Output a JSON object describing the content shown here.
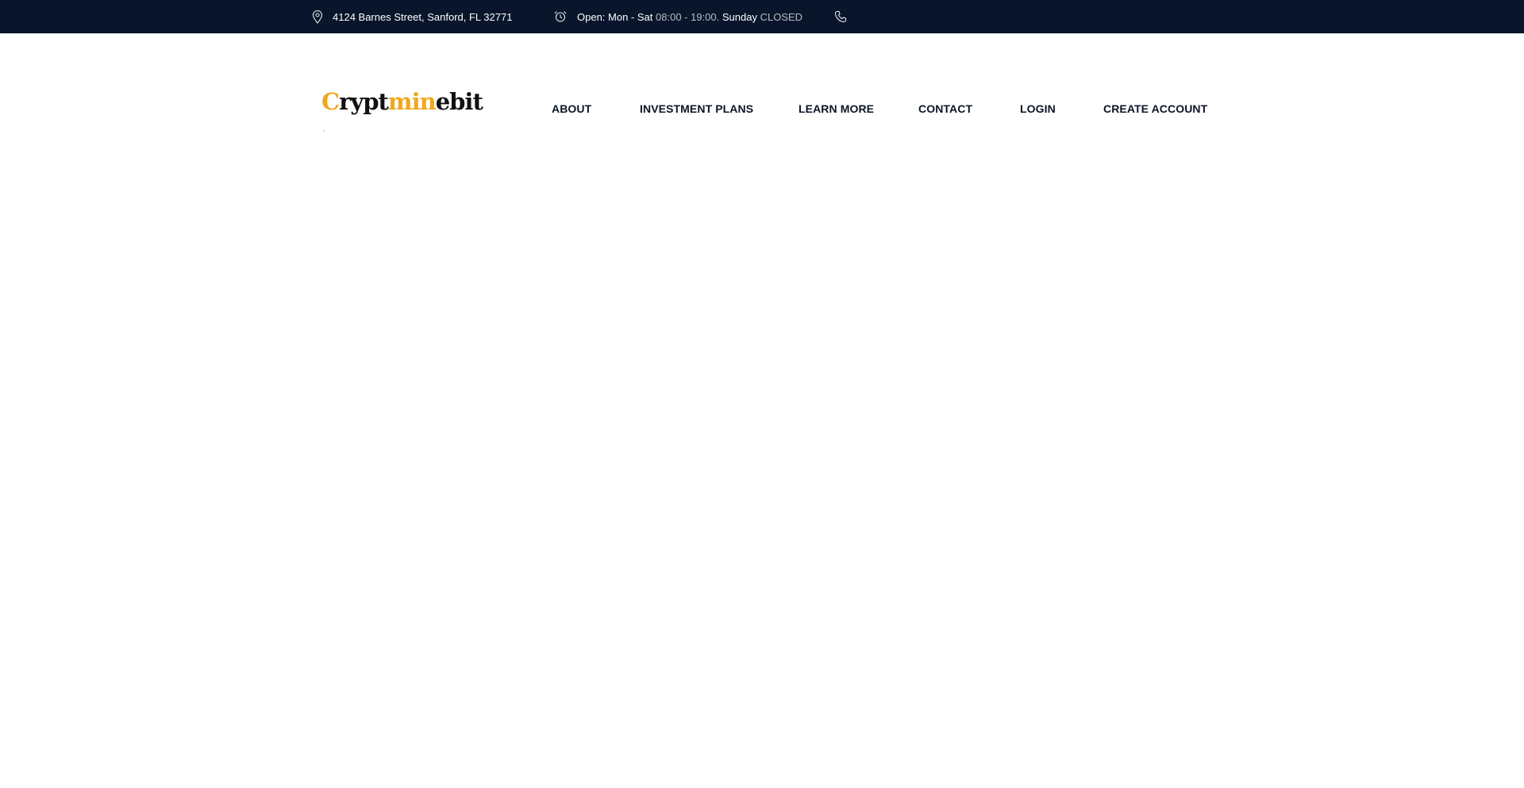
{
  "topbar": {
    "address": "4124 Barnes Street, Sanford, FL 32771",
    "hours_open_label": "Open: Mon - Sat",
    "hours_open_time": "08:00 - 19:00.",
    "hours_sunday_label": "Sunday",
    "hours_sunday_status": "CLOSED",
    "icons": {
      "address": "map-pin-icon",
      "hours": "alarm-clock-icon",
      "phone": "phone-icon"
    },
    "background_color": "#08152b"
  },
  "logo": {
    "part1_accent": "C",
    "part2": "rypt",
    "part3_accent": "min",
    "part4": "ebit",
    "accent_color": "#f0a81a"
  },
  "nav": {
    "about": "ABOUT",
    "investment_plans": "INVESTMENT PLANS",
    "learn_more": "LEARN MORE",
    "contact": "CONTACT",
    "login": "LOGIN",
    "create_account": "CREATE ACCOUNT"
  }
}
